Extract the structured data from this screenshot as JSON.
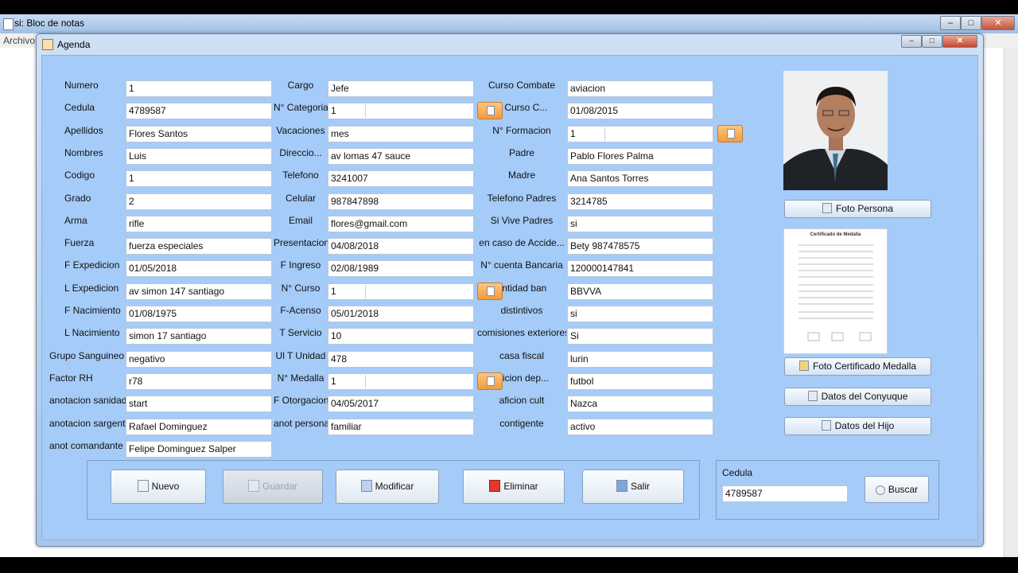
{
  "background_window": {
    "title": "si: Bloc de notas",
    "menu": "Archivo",
    "minimize": "–",
    "maximize": "□",
    "close": "✕"
  },
  "window": {
    "title": "Agenda",
    "minimize": "–",
    "maximize": "□",
    "close": "✕"
  },
  "fields_col1": [
    {
      "label": "Numero",
      "value": "1"
    },
    {
      "label": "Cedula",
      "value": "4789587"
    },
    {
      "label": "Apellidos",
      "value": "Flores Santos"
    },
    {
      "label": "Nombres",
      "value": "Luis"
    },
    {
      "label": "Codigo",
      "value": "1"
    },
    {
      "label": "Grado",
      "value": "2"
    },
    {
      "label": "Arma",
      "value": "rifle"
    },
    {
      "label": "Fuerza",
      "value": "fuerza especiales"
    },
    {
      "label": "F Expedicion",
      "value": "01/05/2018"
    },
    {
      "label": "L Expedicion",
      "value": "av simon 147 santiago"
    },
    {
      "label": "F Nacimiento",
      "value": "01/08/1975"
    },
    {
      "label": "L Nacimiento",
      "value": " simon 17 santiago"
    },
    {
      "label": "Grupo Sanguineo",
      "value": "negativo"
    },
    {
      "label": "Factor RH",
      "value": "r78"
    },
    {
      "label": "anotacion  sanidad",
      "value": "start"
    },
    {
      "label": "anotacion sargento",
      "value": "Rafael Dominguez"
    },
    {
      "label": "anot comandante",
      "value": "Felipe Dominguez Salper"
    }
  ],
  "fields_col2": [
    {
      "label": "Cargo",
      "value": "Jefe"
    },
    {
      "label": "N° Categoria",
      "value": "1"
    },
    {
      "label": "Vacaciones",
      "value": "mes"
    },
    {
      "label": "Direccio...",
      "value": "av lomas 47 sauce"
    },
    {
      "label": "Telefono",
      "value": "3241007"
    },
    {
      "label": "Celular",
      "value": "987847898"
    },
    {
      "label": "Email",
      "value": "flores@gmail.com"
    },
    {
      "label": "Presentacion",
      "value": "04/08/2018"
    },
    {
      "label": "F Ingreso",
      "value": "02/08/1989"
    },
    {
      "label": "N° Curso",
      "value": "1"
    },
    {
      "label": "F-Acenso",
      "value": "05/01/2018"
    },
    {
      "label": "T Servicio",
      "value": "10"
    },
    {
      "label": "Ul T Unidad",
      "value": "478"
    },
    {
      "label": "N° Medalla",
      "value": "1"
    },
    {
      "label": "F Otorgacion",
      "value": "04/05/2017"
    },
    {
      "label": "anot personal",
      "value": "familiar"
    }
  ],
  "fields_col3": [
    {
      "label": "Curso Combate",
      "value": "aviacion"
    },
    {
      "label": "F Curso C...",
      "value": "01/08/2015"
    },
    {
      "label": "N° Formacion",
      "value": "1"
    },
    {
      "label": "Padre",
      "value": "Pablo Flores Palma"
    },
    {
      "label": "Madre",
      "value": "Ana Santos Torres"
    },
    {
      "label": "Telefono Padres",
      "value": "3214785"
    },
    {
      "label": "Si Vive Padres",
      "value": "si"
    },
    {
      "label": "en caso de Accide...",
      "value": "Bety 987478575"
    },
    {
      "label": "N° cuenta Bancaria",
      "value": "120000147841"
    },
    {
      "label": "entidad ban",
      "value": "BBVVA"
    },
    {
      "label": "distintivos",
      "value": "si"
    },
    {
      "label": "comisiones exteriores",
      "value": "Si"
    },
    {
      "label": "casa fiscal",
      "value": "lurin"
    },
    {
      "label": "aficion dep...",
      "value": "futbol"
    },
    {
      "label": "aficion cult",
      "value": "Nazca"
    },
    {
      "label": "contigente",
      "value": "activo"
    }
  ],
  "side_buttons": {
    "foto_persona": "Foto Persona",
    "foto_certificado": "Foto Certificado Medalla",
    "datos_conyugue": "Datos del Conyuque",
    "datos_hijo": "Datos del Hijo"
  },
  "certificate_title": "Certificado de Medalla",
  "actions": {
    "nuevo": "Nuevo",
    "guardar": "Guardar",
    "modificar": "Modificar",
    "eliminar": "Eliminar",
    "salir": "Salir"
  },
  "search": {
    "label": "Cedula",
    "value": "4789587",
    "button": "Buscar"
  }
}
